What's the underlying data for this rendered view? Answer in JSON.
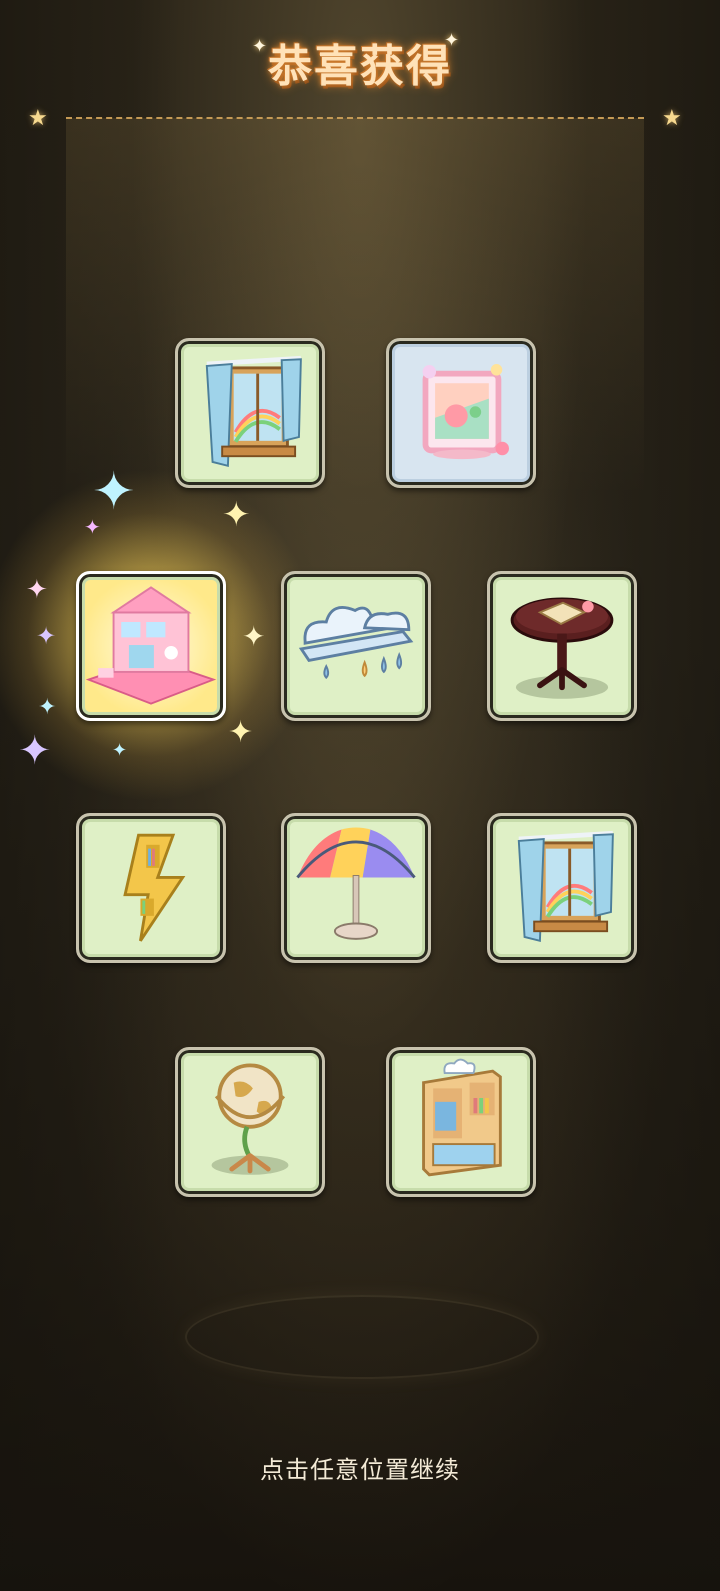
{
  "title": "恭喜获得",
  "continue_hint": "点击任意位置继续",
  "rewards": [
    {
      "item": "rain-curtain-window-icon",
      "rarity": "normal"
    },
    {
      "item": "candy-frame-window-icon",
      "rarity": "normal"
    },
    {
      "item": "pink-dollhouse-scene-icon",
      "rarity": "highlighted"
    },
    {
      "item": "rain-cloud-shelf-icon",
      "rarity": "normal"
    },
    {
      "item": "round-table-with-book-icon",
      "rarity": "normal"
    },
    {
      "item": "lightning-bookshelf-icon",
      "rarity": "normal"
    },
    {
      "item": "rainbow-umbrella-table-icon",
      "rarity": "normal"
    },
    {
      "item": "rain-curtain-window-icon",
      "rarity": "normal"
    },
    {
      "item": "globe-stand-icon",
      "rarity": "normal"
    },
    {
      "item": "cloud-wardrobe-icon",
      "rarity": "normal"
    }
  ],
  "colors": {
    "title_glow": "#e38b2f",
    "card_bg": "#dff0c6",
    "highlight": "#ffe98a"
  }
}
